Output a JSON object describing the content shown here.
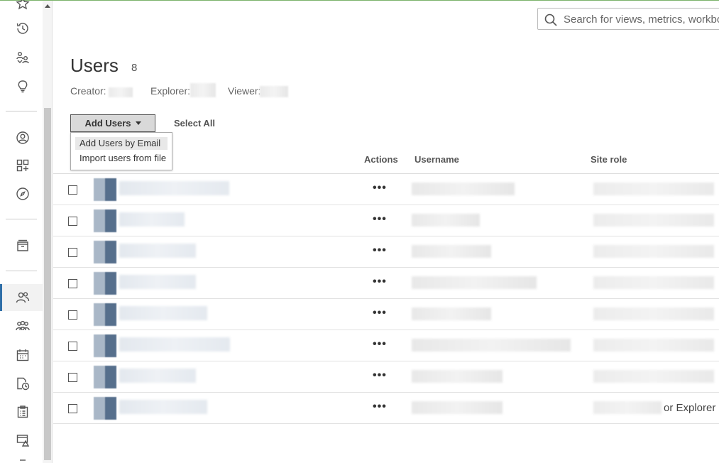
{
  "search": {
    "placeholder": "Search for views, metrics, workbooks"
  },
  "page": {
    "title": "Users",
    "count": "8"
  },
  "license_roles": [
    {
      "label": "Creator:"
    },
    {
      "label": "Explorer:"
    },
    {
      "label": "Viewer:"
    }
  ],
  "toolbar": {
    "add_users_label": "Add Users",
    "select_all_label": "Select All"
  },
  "add_users_menu": {
    "items": [
      "Add Users by Email",
      "Import users from file"
    ]
  },
  "table": {
    "columns": {
      "actions": "Actions",
      "username": "Username",
      "site_role": "Site role"
    },
    "rows": [
      {
        "actions": "•••",
        "site_role": ""
      },
      {
        "actions": "•••",
        "site_role": ""
      },
      {
        "actions": "•••",
        "site_role": ""
      },
      {
        "actions": "•••",
        "site_role": ""
      },
      {
        "actions": "•••",
        "site_role": ""
      },
      {
        "actions": "•••",
        "site_role": ""
      },
      {
        "actions": "•••",
        "site_role": ""
      },
      {
        "actions": "•••",
        "site_role": "or Explorer"
      }
    ]
  },
  "nav": {
    "icons": [
      "star-icon",
      "history-icon",
      "shared-with-me-icon",
      "recommendations-icon",
      "personal-space-icon",
      "collections-icon",
      "explore-icon",
      "external-assets-icon",
      "users-icon",
      "groups-icon",
      "schedules-icon",
      "jobs-icon",
      "tasks-icon",
      "data-alerts-icon"
    ]
  },
  "colors": {
    "accent": "#2f6fa8",
    "top_border": "#7cb36b"
  }
}
